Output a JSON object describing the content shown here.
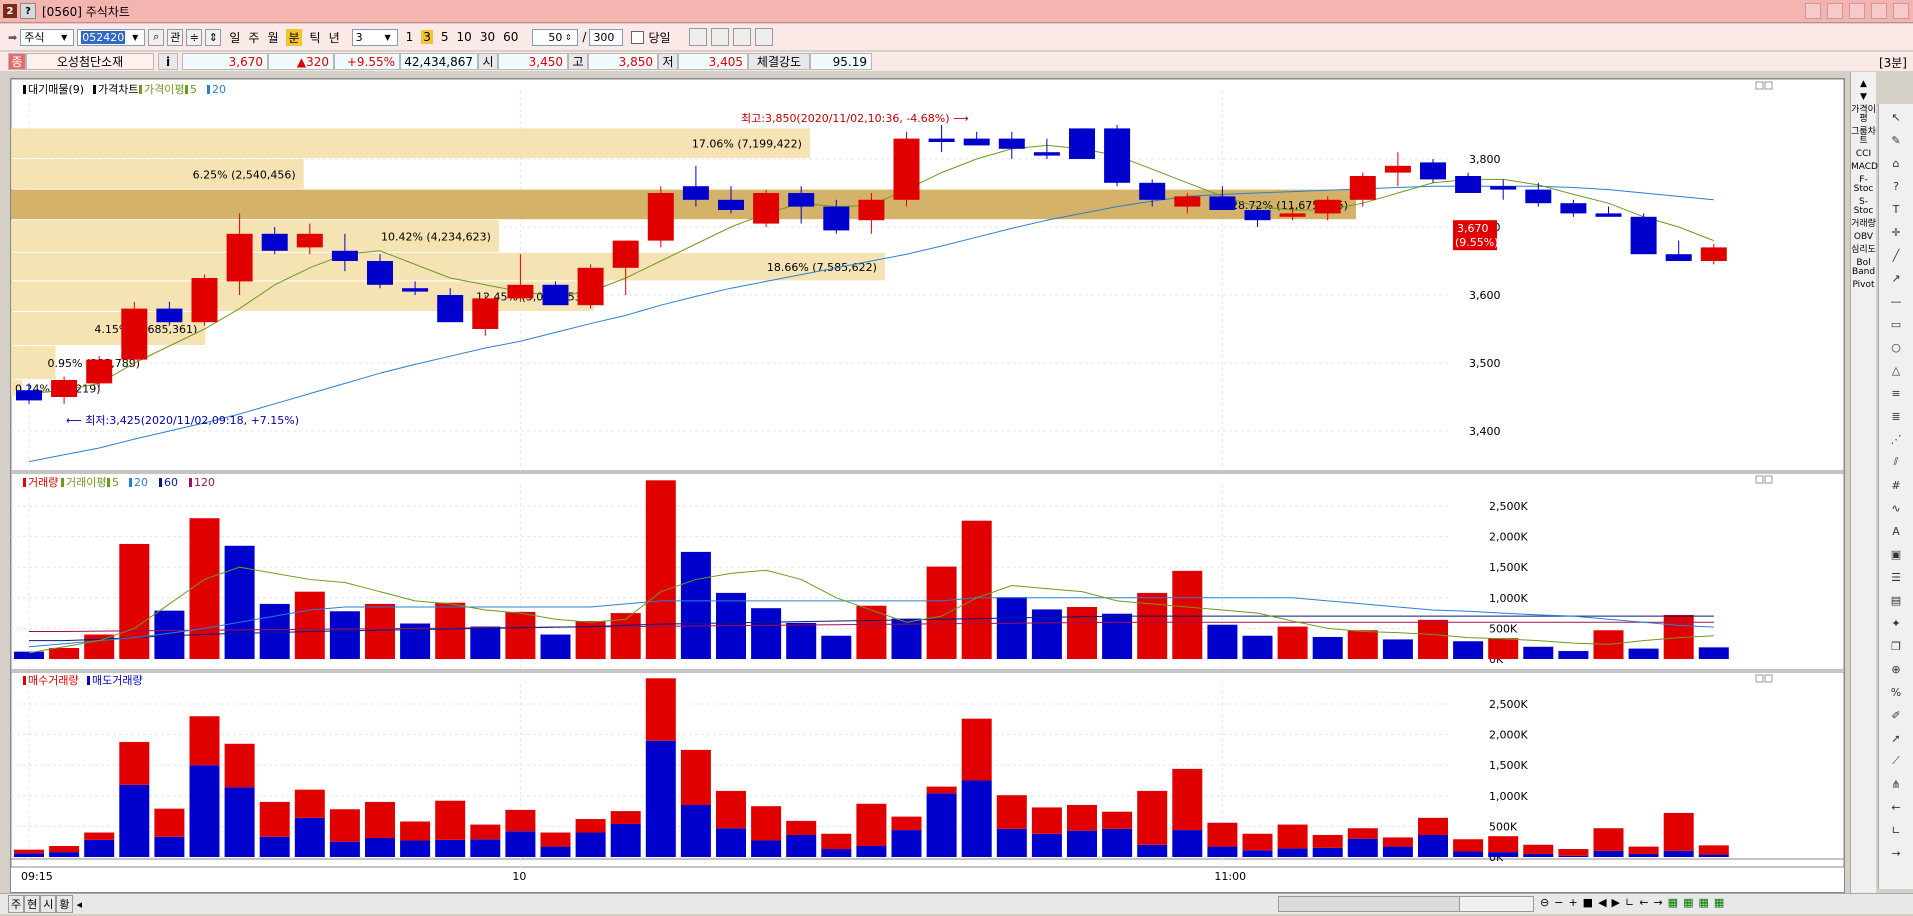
{
  "window": {
    "code": "[0560]",
    "title": "주식차트"
  },
  "toolbar": {
    "market": "주식",
    "stock_code": "052420",
    "btn_gwan": "관",
    "periods": [
      "일",
      "주",
      "월",
      "분",
      "틱",
      "년"
    ],
    "active_period": "분",
    "interval_value": "3",
    "interval_options": [
      "1",
      "3",
      "5",
      "10",
      "30",
      "60"
    ],
    "active_interval": "3",
    "view_count": "50",
    "slash": "/",
    "total_count": "300",
    "today_label": "당일"
  },
  "info": {
    "badge": "종",
    "name": "오성첨단소재",
    "i_label": "i",
    "price": "3,670",
    "change": "▲320",
    "change_pct": "+9.55%",
    "volume": "42,434,867",
    "open_label": "시",
    "open": "3,450",
    "high_label": "고",
    "high": "3,850",
    "low_label": "저",
    "low": "3,405",
    "strength_label": "체결강도",
    "strength": "95.19",
    "timeframe": "[3분]"
  },
  "side_indicators": [
    "가격이평",
    "그룹차트",
    "CCI",
    "MACD",
    "F-Stoc",
    "S-Stoc",
    "거래량",
    "OBV",
    "심리도",
    "Bol Band",
    "Pivot"
  ],
  "bottom": {
    "tabs": [
      "주",
      "현",
      "시",
      "황"
    ]
  },
  "colors": {
    "up": "#e00000",
    "down": "#0000cc",
    "ma5": "#6d9a1f",
    "ma20": "#2a7fd4",
    "profile": "#f6e3b4",
    "profile_max": "#d4b26a"
  },
  "chart_data": [
    {
      "type": "candlestick",
      "legend": [
        "대기매물(9)",
        "가격차트",
        "가격이평",
        "5",
        "20"
      ],
      "x_tick_labels": [
        "09:15",
        "10",
        "11:00"
      ],
      "y_ticks": [
        3400,
        3500,
        3600,
        3700,
        3800
      ],
      "y_tick_labels": [
        "3,400",
        "3,500",
        "3,600",
        "3,700",
        "3,800"
      ],
      "ylim": [
        3360,
        3955
      ],
      "grid": true,
      "candles": [
        [
          3460,
          3470,
          3440,
          3445
        ],
        [
          3450,
          3480,
          3440,
          3475
        ],
        [
          3470,
          3510,
          3465,
          3505
        ],
        [
          3505,
          3590,
          3495,
          3580
        ],
        [
          3580,
          3590,
          3555,
          3560
        ],
        [
          3560,
          3630,
          3555,
          3625
        ],
        [
          3620,
          3720,
          3600,
          3690
        ],
        [
          3690,
          3700,
          3660,
          3665
        ],
        [
          3670,
          3705,
          3660,
          3690
        ],
        [
          3665,
          3690,
          3635,
          3650
        ],
        [
          3650,
          3660,
          3610,
          3615
        ],
        [
          3610,
          3620,
          3600,
          3605
        ],
        [
          3600,
          3610,
          3560,
          3560
        ],
        [
          3550,
          3600,
          3540,
          3595
        ],
        [
          3595,
          3660,
          3590,
          3615
        ],
        [
          3615,
          3620,
          3590,
          3585
        ],
        [
          3585,
          3645,
          3580,
          3640
        ],
        [
          3640,
          3680,
          3600,
          3680
        ],
        [
          3680,
          3760,
          3670,
          3750
        ],
        [
          3760,
          3790,
          3730,
          3740
        ],
        [
          3740,
          3760,
          3720,
          3725
        ],
        [
          3705,
          3755,
          3700,
          3750
        ],
        [
          3750,
          3760,
          3705,
          3730
        ],
        [
          3730,
          3740,
          3690,
          3695
        ],
        [
          3710,
          3750,
          3690,
          3740
        ],
        [
          3740,
          3840,
          3730,
          3830
        ],
        [
          3830,
          3850,
          3810,
          3825
        ],
        [
          3830,
          3840,
          3820,
          3820
        ],
        [
          3830,
          3840,
          3800,
          3815
        ],
        [
          3810,
          3830,
          3800,
          3805
        ],
        [
          3845,
          3845,
          3800,
          3800
        ],
        [
          3845,
          3850,
          3760,
          3765
        ],
        [
          3765,
          3770,
          3730,
          3740
        ],
        [
          3730,
          3750,
          3720,
          3745
        ],
        [
          3745,
          3760,
          3725,
          3725
        ],
        [
          3725,
          3730,
          3700,
          3710
        ],
        [
          3715,
          3730,
          3710,
          3720
        ],
        [
          3720,
          3745,
          3710,
          3740
        ],
        [
          3740,
          3780,
          3730,
          3775
        ],
        [
          3780,
          3810,
          3760,
          3790
        ],
        [
          3795,
          3800,
          3765,
          3770
        ],
        [
          3775,
          3780,
          3750,
          3750
        ],
        [
          3760,
          3770,
          3740,
          3755
        ],
        [
          3755,
          3765,
          3730,
          3735
        ],
        [
          3735,
          3740,
          3715,
          3720
        ],
        [
          3720,
          3730,
          3715,
          3715
        ],
        [
          3715,
          3720,
          3660,
          3660
        ],
        [
          3660,
          3680,
          3650,
          3650
        ],
        [
          3650,
          3675,
          3645,
          3670
        ]
      ],
      "ma5": [
        3455,
        3460,
        3470,
        3500,
        3525,
        3550,
        3580,
        3615,
        3640,
        3660,
        3665,
        3645,
        3625,
        3615,
        3605,
        3598,
        3605,
        3625,
        3650,
        3675,
        3700,
        3720,
        3735,
        3730,
        3732,
        3755,
        3780,
        3800,
        3815,
        3820,
        3815,
        3805,
        3785,
        3765,
        3745,
        3730,
        3725,
        3725,
        3735,
        3750,
        3765,
        3770,
        3770,
        3762,
        3748,
        3735,
        3715,
        3700,
        3680
      ],
      "ma20": [
        3355,
        3365,
        3375,
        3388,
        3400,
        3412,
        3425,
        3440,
        3455,
        3470,
        3485,
        3498,
        3510,
        3522,
        3532,
        3545,
        3558,
        3570,
        3585,
        3598,
        3610,
        3620,
        3630,
        3640,
        3650,
        3660,
        3672,
        3685,
        3698,
        3710,
        3720,
        3730,
        3738,
        3745,
        3748,
        3750,
        3752,
        3754,
        3756,
        3758,
        3760,
        3760,
        3760,
        3760,
        3758,
        3755,
        3750,
        3745,
        3740
      ],
      "volume_profile": [
        {
          "label": "0.24% (10,219)",
          "lo": 3450,
          "hi": 3475,
          "pct": 0.24
        },
        {
          "label": "0.95% (385,789)",
          "lo": 3475,
          "hi": 3525,
          "pct": 0.95
        },
        {
          "label": "4.15% (1,685,361)",
          "lo": 3525,
          "hi": 3575,
          "pct": 4.15
        },
        {
          "label": "12.45% (5,062,553)",
          "lo": 3575,
          "hi": 3620,
          "pct": 12.45
        },
        {
          "label": "18.66% (7,585,622)",
          "lo": 3620,
          "hi": 3662,
          "pct": 18.66
        },
        {
          "label": "10.42% (4,234,623)",
          "lo": 3662,
          "hi": 3710,
          "pct": 10.42
        },
        {
          "label": "28.72% (11,675,775)",
          "lo": 3710,
          "hi": 3755,
          "pct": 28.72
        },
        {
          "label": "6.25% (2,540,456)",
          "lo": 3755,
          "hi": 3800,
          "pct": 6.25
        },
        {
          "label": "17.06% (7,199,422)",
          "lo": 3800,
          "hi": 3845,
          "pct": 17.06
        }
      ],
      "annotations": {
        "high": "최고:3,850(2020/11/02,10:36, -4.68%)",
        "low": "최저:3,425(2020/11/02,09:18, +7.15%)",
        "current_price": "3,670",
        "current_pct": "(9.55%)"
      }
    },
    {
      "type": "bar",
      "legend": [
        "거래량",
        "거래이평",
        "5",
        "20",
        "60",
        "120"
      ],
      "y_ticks": [
        0,
        500,
        1000,
        1500,
        2000,
        2500
      ],
      "y_tick_labels": [
        "0K",
        "500K",
        "1,000K",
        "1,500K",
        "2,000K",
        "2,500K"
      ],
      "ylim": [
        0,
        2950
      ],
      "volumes": [
        120,
        180,
        400,
        1880,
        790,
        2300,
        1850,
        900,
        1100,
        780,
        900,
        580,
        920,
        530,
        770,
        400,
        620,
        750,
        2920,
        1750,
        1080,
        830,
        590,
        380,
        870,
        660,
        1510,
        2260,
        1010,
        810,
        850,
        740,
        1080,
        1440,
        560,
        380,
        530,
        360,
        470,
        320,
        640,
        290,
        340,
        200,
        130,
        470,
        170,
        720,
        190
      ],
      "up": [
        false,
        true,
        true,
        true,
        false,
        true,
        false,
        false,
        true,
        false,
        true,
        false,
        true,
        false,
        true,
        false,
        true,
        true,
        true,
        false,
        false,
        false,
        false,
        false,
        true,
        false,
        true,
        true,
        false,
        false,
        true,
        false,
        true,
        true,
        false,
        false,
        true,
        false,
        true,
        false,
        true,
        false,
        true,
        false,
        false,
        true,
        false,
        true,
        false
      ],
      "ma5": [
        100,
        200,
        300,
        500,
        900,
        1300,
        1500,
        1400,
        1300,
        1250,
        1100,
        950,
        900,
        800,
        750,
        650,
        600,
        650,
        1100,
        1300,
        1400,
        1450,
        1300,
        1000,
        800,
        600,
        700,
        1000,
        1200,
        1150,
        1100,
        950,
        900,
        850,
        800,
        750,
        620,
        500,
        450,
        430,
        400,
        350,
        330,
        300,
        260,
        240,
        300,
        350,
        380
      ],
      "ma20": [
        200,
        250,
        300,
        350,
        420,
        500,
        600,
        700,
        800,
        850,
        850,
        850,
        850,
        850,
        850,
        850,
        850,
        900,
        950,
        950,
        950,
        950,
        950,
        950,
        950,
        950,
        950,
        1000,
        1000,
        1000,
        1000,
        1000,
        1000,
        1000,
        1000,
        1000,
        1000,
        950,
        900,
        850,
        800,
        780,
        750,
        720,
        700,
        650,
        600,
        550,
        520
      ],
      "ma60": [
        300,
        300,
        320,
        350,
        380,
        400,
        420,
        430,
        450,
        460,
        470,
        480,
        490,
        500,
        510,
        520,
        530,
        550,
        570,
        580,
        590,
        600,
        610,
        620,
        630,
        640,
        650,
        660,
        670,
        680,
        690,
        700,
        700,
        700,
        700,
        700,
        700,
        700,
        700,
        700,
        700,
        700,
        700,
        700,
        700,
        700,
        700,
        700,
        700
      ],
      "ma120": [
        450,
        450,
        455,
        460,
        465,
        470,
        475,
        480,
        485,
        490,
        495,
        500,
        505,
        510,
        515,
        520,
        525,
        530,
        535,
        540,
        545,
        550,
        555,
        560,
        565,
        570,
        575,
        580,
        585,
        590,
        595,
        600,
        600,
        600,
        600,
        600,
        600,
        600,
        600,
        600,
        600,
        600,
        600,
        600,
        600,
        600,
        600,
        600,
        600
      ]
    },
    {
      "type": "stacked_bar",
      "legend": [
        "매수거래량",
        "매도거래량"
      ],
      "y_ticks": [
        0,
        500,
        1000,
        1500,
        2000,
        2500
      ],
      "y_tick_labels": [
        "0K",
        "500K",
        "1,000K",
        "1,500K",
        "2,000K",
        "2,500K"
      ],
      "ylim": [
        0,
        2950
      ],
      "buy": [
        60,
        80,
        280,
        1180,
        330,
        1500,
        1140,
        330,
        640,
        250,
        310,
        270,
        280,
        290,
        420,
        170,
        400,
        540,
        1900,
        850,
        470,
        270,
        360,
        130,
        180,
        440,
        1040,
        1250,
        460,
        380,
        430,
        460,
        200,
        440,
        170,
        110,
        140,
        150,
        300,
        170,
        360,
        90,
        80,
        50,
        20,
        100,
        50,
        100,
        40
      ],
      "sell": [
        60,
        100,
        120,
        700,
        460,
        800,
        710,
        570,
        460,
        530,
        590,
        310,
        640,
        240,
        350,
        230,
        220,
        210,
        1020,
        900,
        610,
        560,
        230,
        250,
        690,
        220,
        110,
        1010,
        550,
        430,
        420,
        280,
        880,
        1000,
        390,
        270,
        390,
        210,
        170,
        150,
        280,
        200,
        260,
        150,
        110,
        370,
        120,
        620,
        150
      ]
    }
  ]
}
